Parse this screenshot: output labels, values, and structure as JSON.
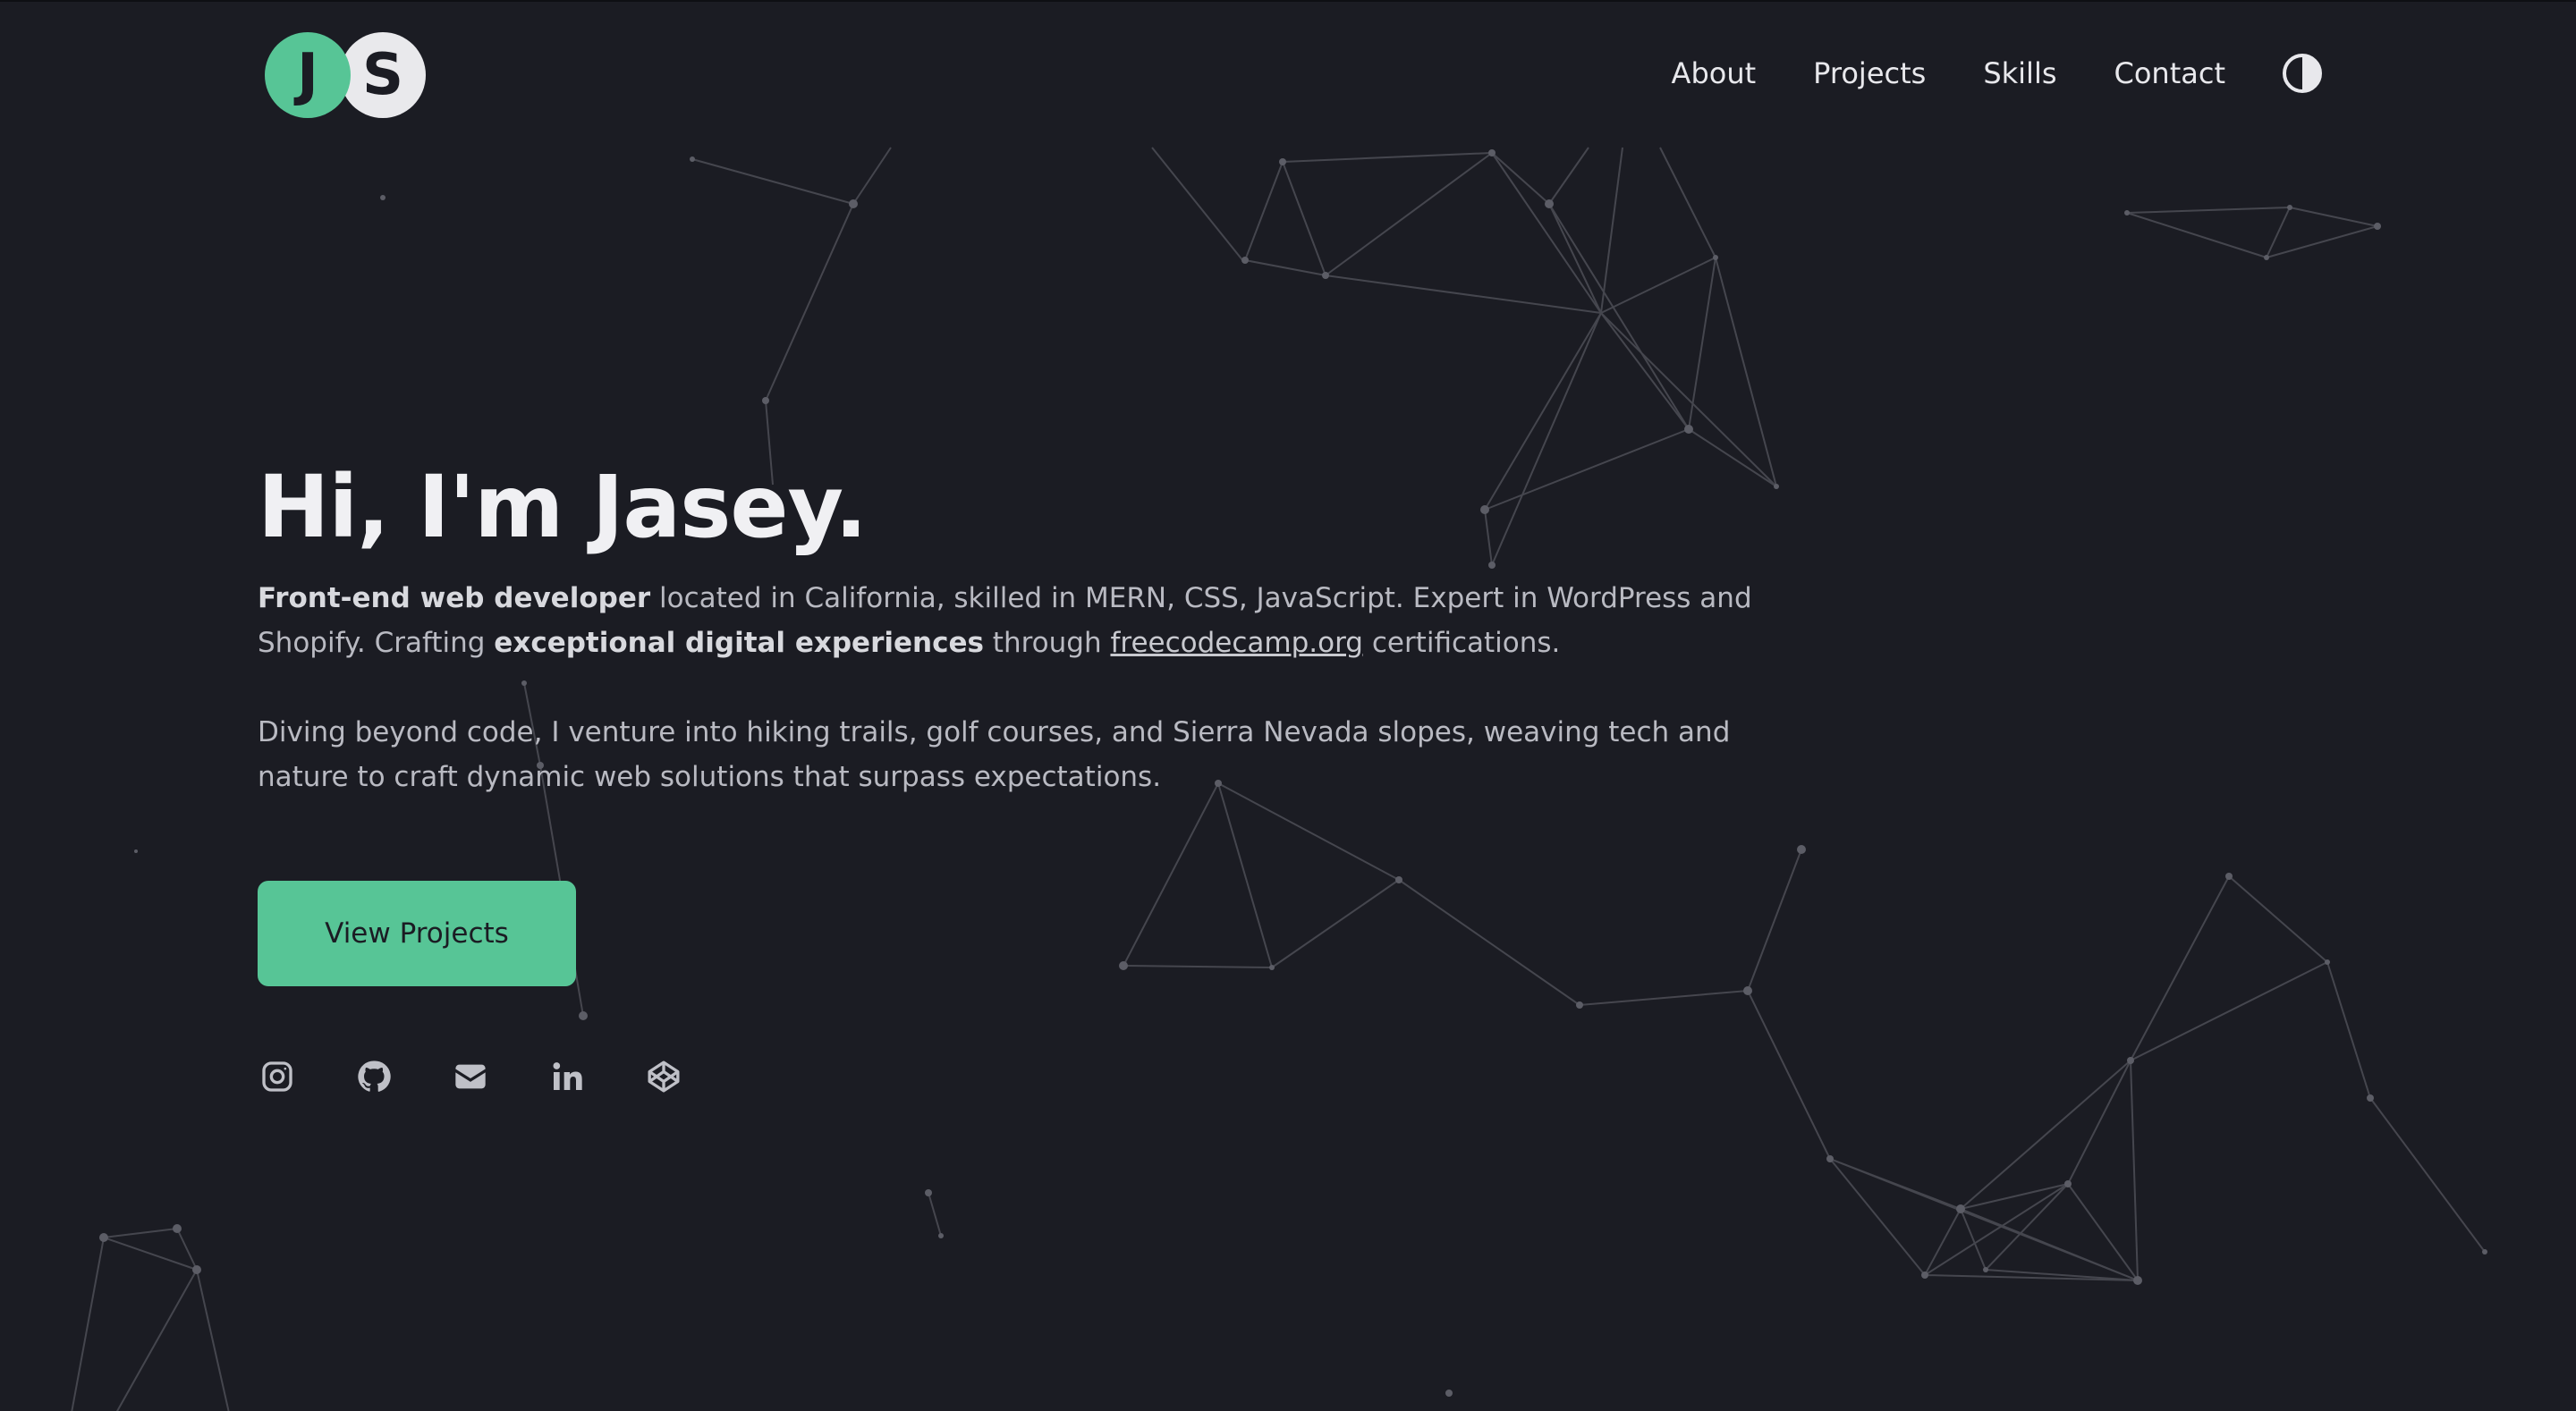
{
  "logo": {
    "letter1": "J",
    "letter2": "S"
  },
  "nav": {
    "items": [
      "About",
      "Projects",
      "Skills",
      "Contact"
    ],
    "theme_toggle_icon": "contrast-icon"
  },
  "hero": {
    "heading": "Hi, I'm Jasey.",
    "p1": {
      "bold1": "Front-end web developer",
      "text1": " located in California, skilled in MERN, CSS, JavaScript. Expert in WordPress and Shopify. Crafting ",
      "bold2": "exceptional digital experiences",
      "text2": " through ",
      "link": "freecodecamp.org",
      "text3": " certifications."
    },
    "p2": "Diving beyond code, I venture into hiking trails, golf courses, and Sierra Nevada slopes, weaving tech and nature to craft dynamic web solutions that surpass expectations.",
    "cta_label": "View Projects"
  },
  "socials": [
    "instagram-icon",
    "github-icon",
    "email-icon",
    "linkedin-icon",
    "codepen-icon"
  ],
  "colors": {
    "background": "#1b1c23",
    "accent": "#57c596",
    "text": "#e8e8ec",
    "muted_text": "#b9bac2",
    "network_line": "#55565e"
  }
}
